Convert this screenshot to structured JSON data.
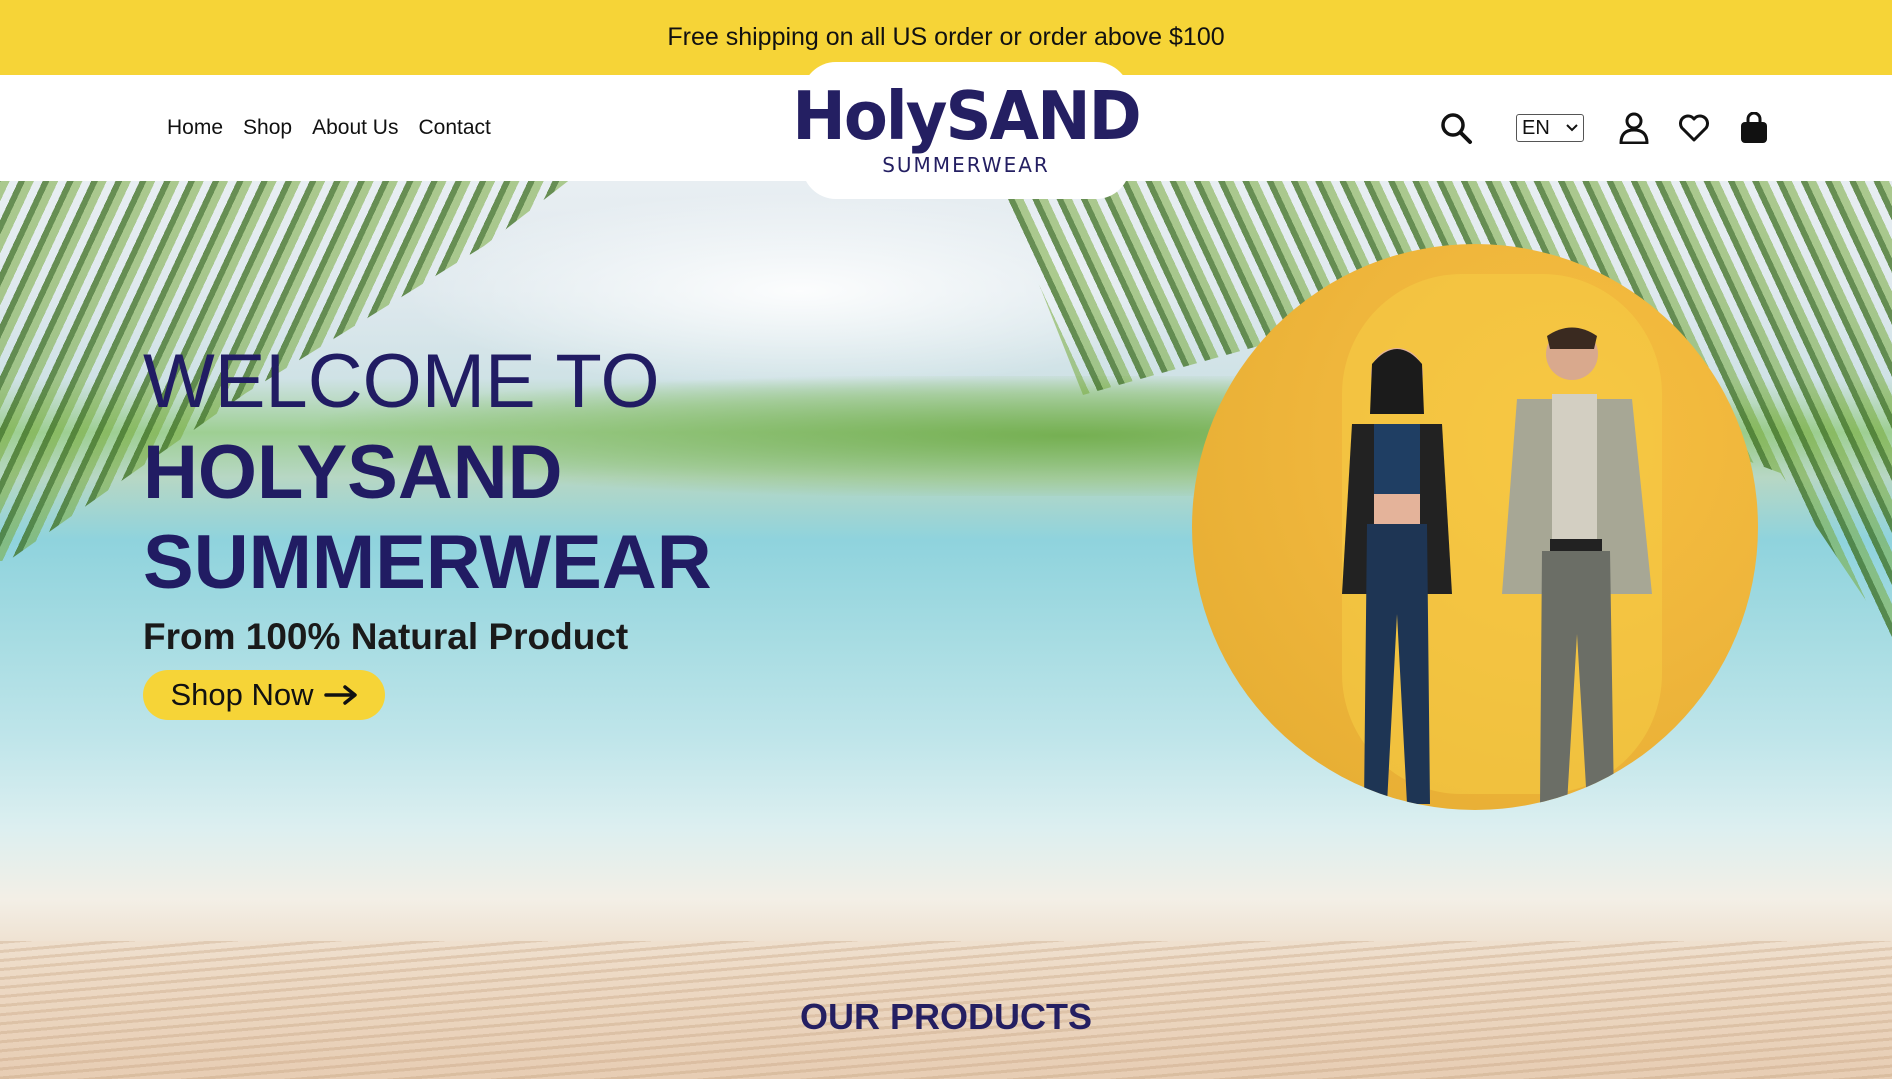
{
  "topbar": {
    "text": "Free shipping on all US order or order above $100"
  },
  "nav": {
    "links": [
      "Home",
      "Shop",
      "About Us",
      "Contact"
    ]
  },
  "logo": {
    "main": "HolySAND",
    "sub": "SUMMERWEAR"
  },
  "header_icons": {
    "search": "search-icon",
    "language": "EN",
    "account": "user-icon",
    "wishlist": "heart-icon",
    "cart": "shopping-bag-icon"
  },
  "hero": {
    "line1": "WELCOME TO",
    "line2": "HOLYSAND",
    "line3": "SUMMERWEAR",
    "tagline": "From 100% Natural Product",
    "cta": "Shop Now"
  },
  "products": {
    "title": "OUR PRODUCTS"
  },
  "colors": {
    "accent_yellow": "#f6d437",
    "brand_navy": "#241f62"
  }
}
